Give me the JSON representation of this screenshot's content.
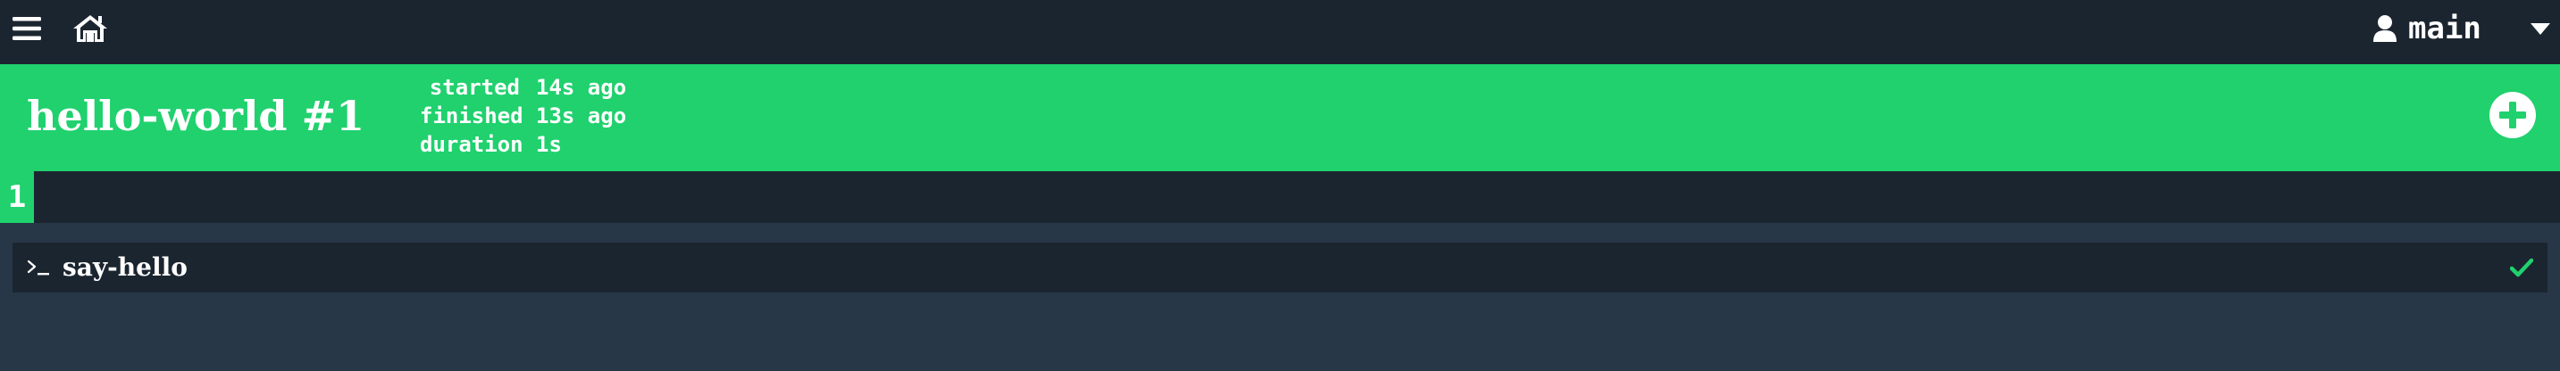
{
  "topbar": {
    "menu_icon": "hamburger-menu-icon",
    "home_icon": "home-icon",
    "user": {
      "icon": "user-icon",
      "name": "main",
      "caret": "caret-down-icon"
    }
  },
  "build": {
    "title": "hello-world #1",
    "status_color": "#20d16e",
    "meta": [
      {
        "label": "started",
        "value": "14s ago"
      },
      {
        "label": "finished",
        "value": "13s ago"
      },
      {
        "label": "duration",
        "value": "1s"
      }
    ],
    "action_icon": "plus-circle-icon"
  },
  "tabs": [
    {
      "label": "1",
      "active": true
    }
  ],
  "tasks": [
    {
      "icon": "terminal-icon",
      "name": "say-hello",
      "status": "succeeded",
      "status_icon": "check-icon"
    }
  ],
  "colors": {
    "background": "#273747",
    "bar": "#1b2530",
    "success": "#20d16e",
    "text": "#ffffff"
  }
}
